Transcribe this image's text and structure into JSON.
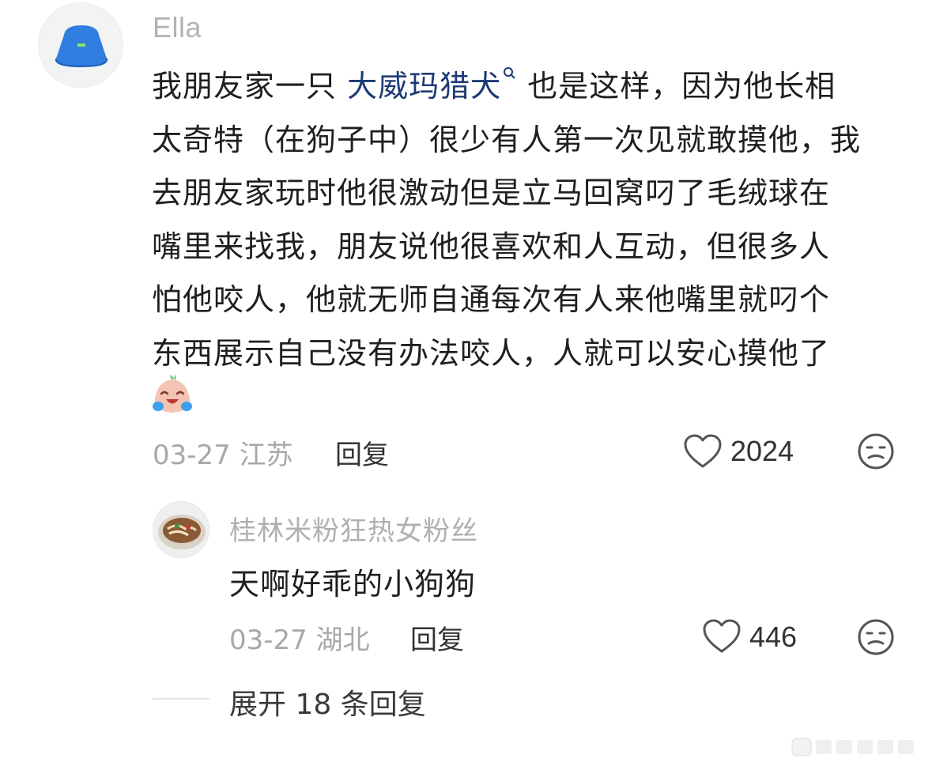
{
  "main_comment": {
    "username": "Ella",
    "avatar_icon": "bucket-hat-icon",
    "lines": [
      {
        "pre": "我朋友家一只 ",
        "link": "大威玛猎犬",
        "post": " 也是这样，因为他长相"
      },
      {
        "text": "太奇特（在狗子中）很少有人第一次见就敢摸他，我"
      },
      {
        "text": "去朋友家玩时他很激动但是立马回窝叼了毛绒球在"
      },
      {
        "text": "嘴里来找我，朋友说他很喜欢和人互动，但很多人"
      },
      {
        "text": "怕他咬人，他就无师自通每次有人来他嘴里就叼个"
      },
      {
        "text": "东西展示自己没有办法咬人，人就可以安心摸他了"
      }
    ],
    "emoji": "laugh-cry-emoji",
    "date_location": "03-27 江苏",
    "reply_label": "回复",
    "likes": "2024"
  },
  "sub_comment": {
    "username": "桂林米粉狂热女粉丝",
    "avatar_icon": "rice-noodle-bowl-icon",
    "text": "天啊好乖的小狗狗",
    "date_location": "03-27 湖北",
    "reply_label": "回复",
    "likes": "446"
  },
  "expand_replies": "展开 18 条回复",
  "colors": {
    "link": "#1d3a73",
    "muted": "#a8a8a8",
    "text": "#1f1f1f"
  }
}
